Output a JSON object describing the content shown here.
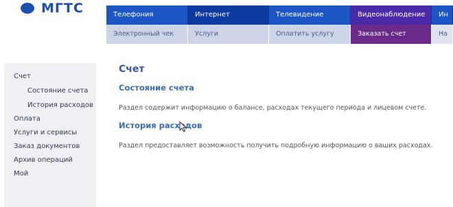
{
  "brand": {
    "logo_text": "МГТС"
  },
  "topnav": [
    "Телефония",
    "Интернет",
    "Телевидение",
    "Видеонаблюдение",
    "Ин"
  ],
  "subnav": [
    "Электронный чек",
    "Услуги",
    "Оплатить услугу",
    "Заказать счет",
    "На"
  ],
  "sidebar": {
    "items": [
      {
        "label": "Счет"
      },
      {
        "label": "Состояние счета"
      },
      {
        "label": "История расходов"
      },
      {
        "label": "Оплата"
      },
      {
        "label": "Услуги и сервисы"
      },
      {
        "label": "Заказ документов"
      },
      {
        "label": "Архив операций"
      },
      {
        "label": "Мой"
      }
    ]
  },
  "main": {
    "title": "Счет",
    "sections": [
      {
        "title": "Состояние счета",
        "text": "Раздел содержит информацию о балансе, расходах текущего периода и лицевом счете."
      },
      {
        "title": "История расходов",
        "text": "Раздел предоставляет возможность получить подробную информацию о ваших расходах."
      }
    ]
  },
  "colors": {
    "brand_blue": "#1a4fb0",
    "nav_blue": "#1c56c4",
    "active_purple": "#6a2a8a",
    "link_blue": "#3a6aba"
  }
}
